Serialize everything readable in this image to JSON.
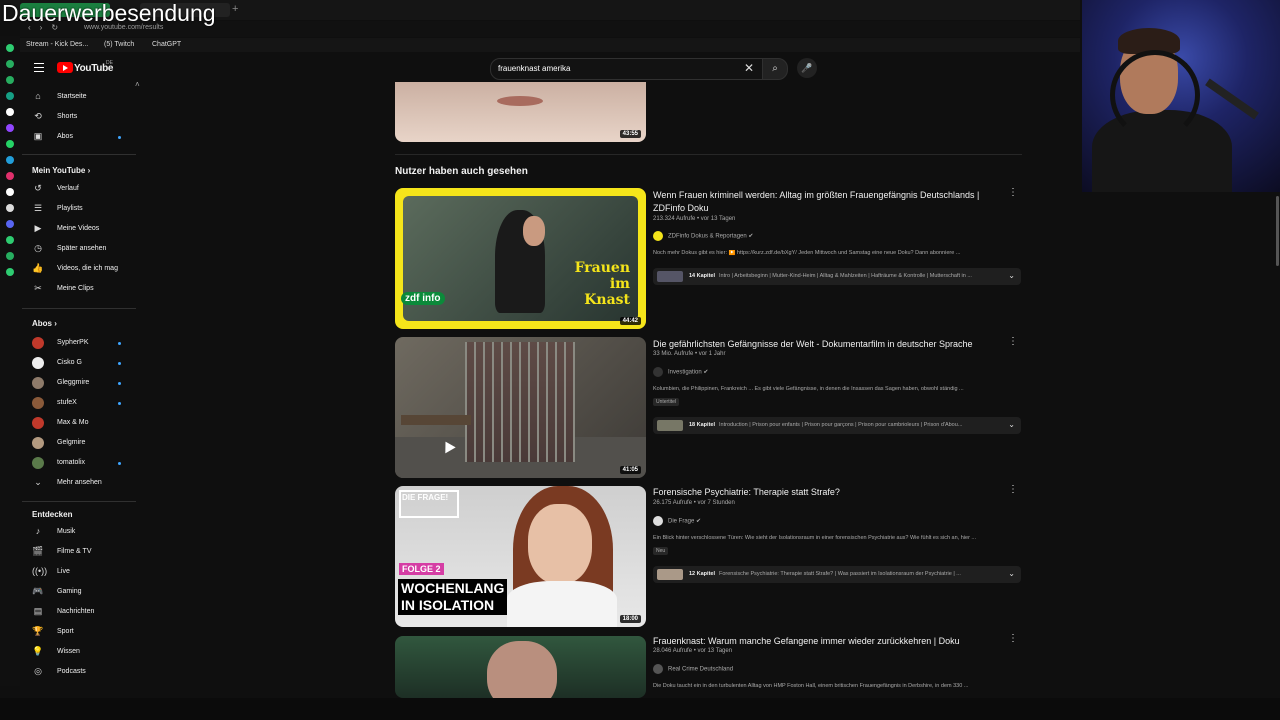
{
  "overlay_text": "Dauerwerbesendung",
  "browser": {
    "url": "www.youtube.com/results",
    "bookmarks": [
      "Stream - Kick Des...",
      "(5) Twitch",
      "ChatGPT"
    ]
  },
  "header": {
    "logo_text": "YouTube",
    "region": "DE",
    "search_value": "frauenknast amerika"
  },
  "sidebar": {
    "main": [
      {
        "label": "Startseite",
        "icon": "⌂"
      },
      {
        "label": "Shorts",
        "icon": "⟲"
      },
      {
        "label": "Abos",
        "icon": "▣"
      }
    ],
    "my_heading": "Mein YouTube",
    "my": [
      {
        "label": "Verlauf",
        "icon": "↺"
      },
      {
        "label": "Playlists",
        "icon": "☰"
      },
      {
        "label": "Meine Videos",
        "icon": "▶"
      },
      {
        "label": "Später ansehen",
        "icon": "◷"
      },
      {
        "label": "Videos, die ich mag",
        "icon": "👍"
      },
      {
        "label": "Meine Clips",
        "icon": "✂"
      }
    ],
    "subs_heading": "Abos",
    "subs": [
      {
        "label": "SypherPK",
        "color": "#c0392b"
      },
      {
        "label": "Cisko G",
        "color": "#eeeeee"
      },
      {
        "label": "Gleggmire",
        "color": "#8e7b6a"
      },
      {
        "label": "stufeX",
        "color": "#8a5a3a"
      },
      {
        "label": "Max & Mo",
        "color": "#c0392b"
      },
      {
        "label": "Gelgmire",
        "color": "#b39a80"
      },
      {
        "label": "tomatolix",
        "color": "#5a7a4a"
      }
    ],
    "show_more": "Mehr ansehen",
    "explore_heading": "Entdecken",
    "explore": [
      {
        "label": "Musik",
        "icon": "♪"
      },
      {
        "label": "Filme & TV",
        "icon": "🎬"
      },
      {
        "label": "Live",
        "icon": "((•))"
      },
      {
        "label": "Gaming",
        "icon": "🎮"
      },
      {
        "label": "Nachrichten",
        "icon": "▤"
      },
      {
        "label": "Sport",
        "icon": "🏆"
      },
      {
        "label": "Wissen",
        "icon": "💡"
      },
      {
        "label": "Podcasts",
        "icon": "◎"
      }
    ]
  },
  "top_video": {
    "duration": "43:55"
  },
  "section_title": "Nutzer haben auch gesehen",
  "videos": [
    {
      "title": "Wenn Frauen kriminell werden: Alltag im größten Frauengefängnis Deutschlands | ZDFinfo Doku",
      "meta": "213.324 Aufrufe • vor 13 Tagen",
      "channel": "ZDFinfo Dokus & Reportagen",
      "description": "Noch mehr Dokus gibt es hier: ▶️ https://kurz.zdf.de/bXgY/ Jeden Mittwoch und Samstag eine neue Doku? Dann abonniere ...",
      "chapters_count": "14 Kapitel",
      "chapters": "Intro | Arbeitsbeginn | Mutter-Kind-Heim | Alltag & Mahlzeiten | Hafträume & Kontrolle | Mutterschaft in ...",
      "duration": "44:42",
      "thumb_title": "Frauen im Knast",
      "thumb_brand": "zdf info"
    },
    {
      "title": "Die gefährlichsten Gefängnisse der Welt - Dokumentarfilm in deutscher Sprache",
      "meta": "33 Mio. Aufrufe • vor 1 Jahr",
      "channel": "Investigation",
      "description": "Kolumbien, die Philippinen, Frankreich ... Es gibt viele Gefängnisse, in denen die Insassen das Sagen haben, obwohl ständig ...",
      "badge": "Untertitel",
      "chapters_count": "18 Kapitel",
      "chapters": "Introduction | Prison pour enfants | Prison pour garçons | Prison pour cambrioleurs | Prison d'Abou...",
      "duration": "41:05"
    },
    {
      "title": "Forensische Psychiatrie: Therapie statt Strafe?",
      "meta": "26.175 Aufrufe • vor 7 Stunden",
      "channel": "Die Frage",
      "description": "Ein Blick hinter verschlossene Türen: Wie sieht der Isolationsraum in einer forensischen Psychiatrie aus? Wie fühlt es sich an, hier ...",
      "badge": "Neu",
      "chapters_count": "12 Kapitel",
      "chapters": "Forensische Psychiatrie: Therapie statt Strafe? | Was passiert im Isolationsraum der Psychiatrie | ...",
      "duration": "18:00",
      "thumb_logo": "DIE FRAGE!",
      "thumb_folge": "FOLGE 2",
      "thumb_big1": "WOCHENLANG",
      "thumb_big2": "IN ISOLATION"
    },
    {
      "title": "Frauenknast: Warum manche Gefangene immer wieder zurückkehren | Doku",
      "meta": "28.046 Aufrufe • vor 13 Tagen",
      "channel": "Real Crime Deutschland",
      "description": "Die Doku taucht ein in den turbulenten Alltag von HMP Foston Hall, einem britischen Frauengefängnis in Derbshire, in dem 330 ..."
    }
  ]
}
